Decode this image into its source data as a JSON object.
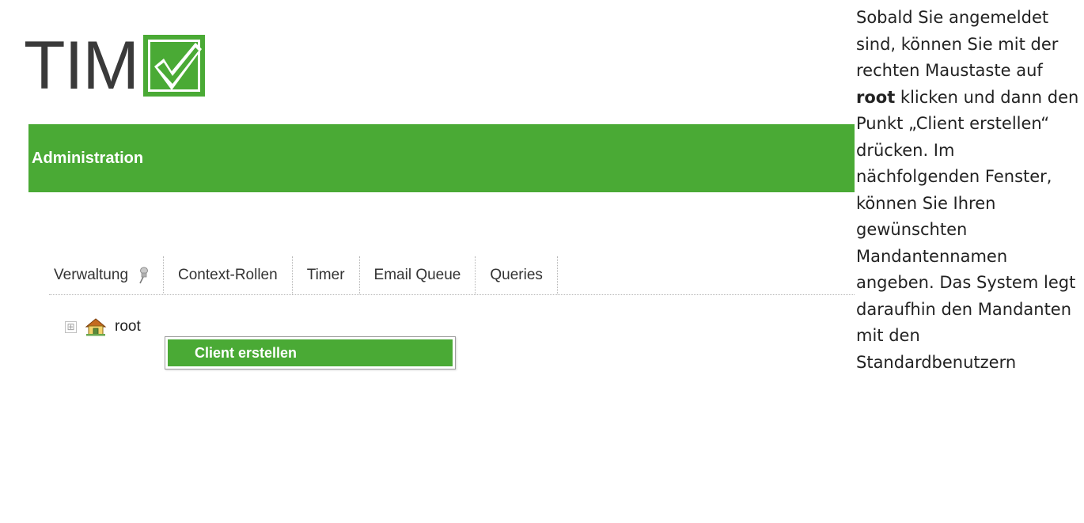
{
  "logo": {
    "text": "TIM",
    "accent_color": "#4aaa35",
    "mark_icon": "check-mark-icon"
  },
  "admin_bar": {
    "title": "Administration",
    "color": "#4aaa35"
  },
  "tabs": [
    {
      "label": "Verwaltung",
      "icon": "pin-icon"
    },
    {
      "label": "Context-Rollen"
    },
    {
      "label": "Timer"
    },
    {
      "label": "Email Queue"
    },
    {
      "label": "Queries"
    }
  ],
  "tree": {
    "expander": "⊞",
    "root_icon": "home-icon",
    "root_label": "root"
  },
  "context_menu": {
    "items": [
      {
        "label": "Client erstellen"
      }
    ]
  },
  "description": {
    "before_bold": " Sobald Sie angemeldet sind, können Sie mit der rechten Maustaste auf ",
    "bold": "root",
    "after_bold": " klicken und dann den Punkt „Client erstellen“ drücken. Im nächfolgenden Fenster, können Sie Ihren gewünschten Mandantennamen angeben. Das System legt daraufhin den Mandanten mit den Standardbenutzern"
  }
}
